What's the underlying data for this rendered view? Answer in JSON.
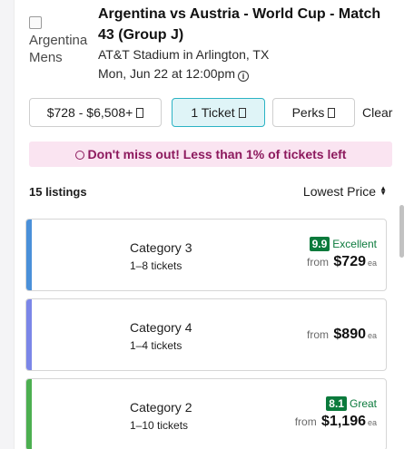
{
  "event": {
    "image_alt": "Argentina Mens",
    "title": "Argentina vs Austria - World Cup - Match 43 (Group J)",
    "venue": "AT&T Stadium in Arlington, TX",
    "datetime": "Mon, Jun 22 at 12:00pm"
  },
  "filters": {
    "price_range": "$728 - $6,508+",
    "quantity": "1 Ticket",
    "perks": "Perks",
    "clear": "Clear"
  },
  "alert": {
    "message": "Don't miss out! Less than 1% of tickets left"
  },
  "listing_header": {
    "count": "15 listings",
    "sort": "Lowest Price"
  },
  "listings": [
    {
      "category": "Category 3",
      "tickets": "1–8 tickets",
      "score": "9.9",
      "rating": "Excellent",
      "from": "from",
      "price": "$729",
      "unit": "ea",
      "stripe_color": "#4a90d9"
    },
    {
      "category": "Category 4",
      "tickets": "1–4 tickets",
      "from": "from",
      "price": "$890",
      "unit": "ea",
      "stripe_color": "#7b86e8"
    },
    {
      "category": "Category 2",
      "tickets": "1–10 tickets",
      "score": "8.1",
      "rating": "Great",
      "from": "from",
      "price": "$1,196",
      "unit": "ea",
      "stripe_color": "#4caf50"
    }
  ],
  "colors": {
    "accent": "#2bb3c4",
    "alert_bg": "#fae4f1",
    "alert_text": "#8d1a5e",
    "rating_green": "#0b7a3c"
  }
}
